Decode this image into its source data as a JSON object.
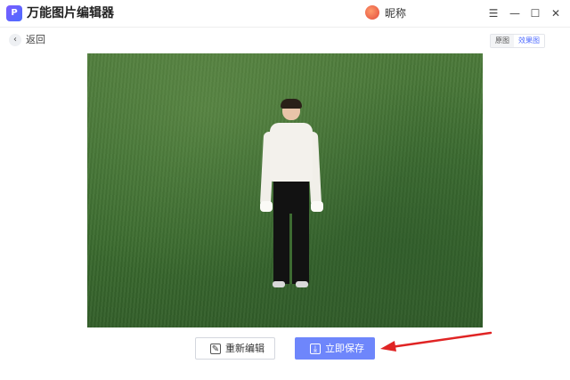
{
  "app": {
    "title": "万能图片编辑器",
    "logo_glyph": "P"
  },
  "user": {
    "name": "昵称"
  },
  "window_controls": {
    "menu": "☰",
    "minimize": "—",
    "maximize": "☐",
    "close": "✕"
  },
  "nav": {
    "back_label": "返回",
    "back_icon": "‹"
  },
  "view_toggle": {
    "original": "原图",
    "result": "效果图",
    "selected": "result"
  },
  "actions": {
    "reedit_label": "重新编辑",
    "reedit_icon": "✎",
    "save_label": "立即保存",
    "save_icon": "⤓"
  },
  "colors": {
    "accent": "#6e86fb",
    "arrow": "#e02424",
    "result_tab": "#4f6bff"
  },
  "icons": {
    "logo": "app-logo-icon",
    "avatar": "user-avatar-icon",
    "back": "back-arrow-icon",
    "reedit": "edit-pencil-icon",
    "save": "download-save-icon",
    "annotation": "red-arrow-annotation"
  }
}
